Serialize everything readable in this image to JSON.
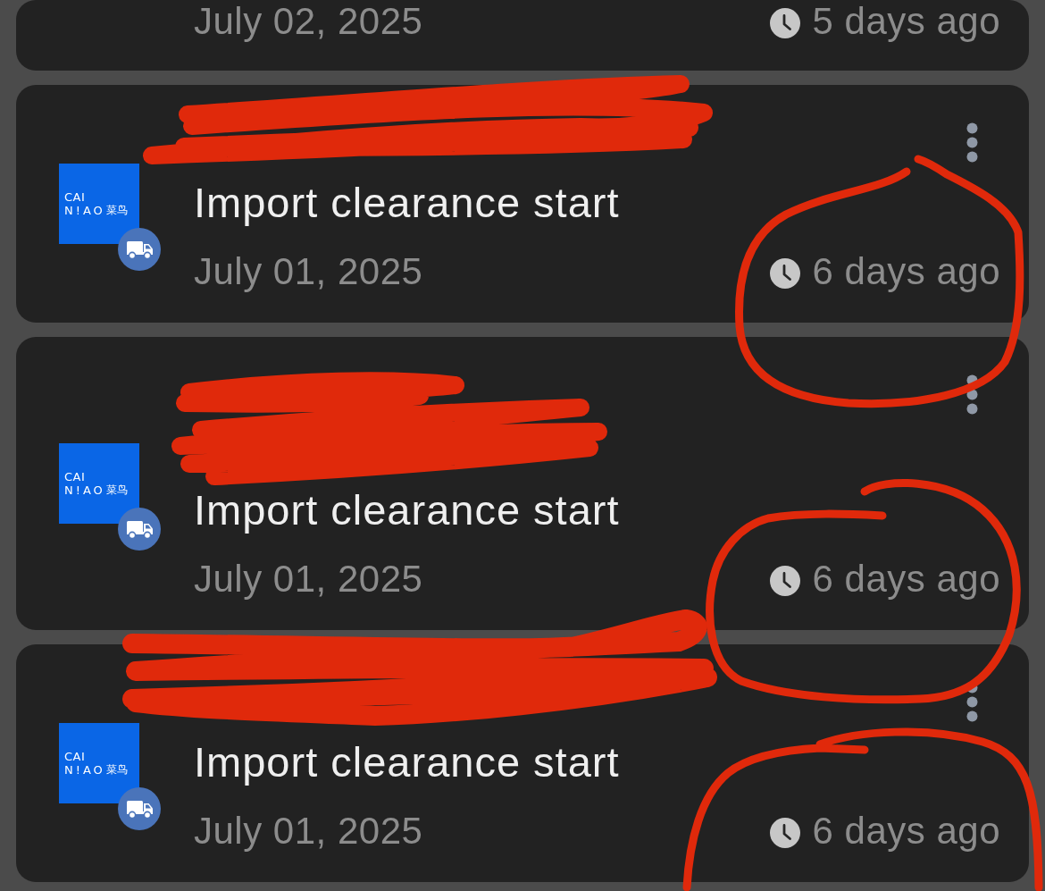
{
  "shipments": [
    {
      "date": "July 02, 2025",
      "time_ago": "5 days ago"
    },
    {
      "carrier_logo": {
        "wordmark": [
          "CAI",
          "N!AO"
        ],
        "chinese_name": "菜鸟"
      },
      "status": "Import clearance start",
      "date": "July 01, 2025",
      "time_ago": "6 days ago"
    },
    {
      "carrier_logo": {
        "wordmark": [
          "CAI",
          "N!AO"
        ],
        "chinese_name": "菜鸟"
      },
      "status": "Import clearance start",
      "date": "July 01, 2025",
      "time_ago": "6 days ago"
    },
    {
      "carrier_logo": {
        "wordmark": [
          "CAI",
          "N!AO"
        ],
        "chinese_name": "菜鸟"
      },
      "status": "Import clearance start",
      "date": "July 01, 2025",
      "time_ago": "6 days ago"
    }
  ]
}
